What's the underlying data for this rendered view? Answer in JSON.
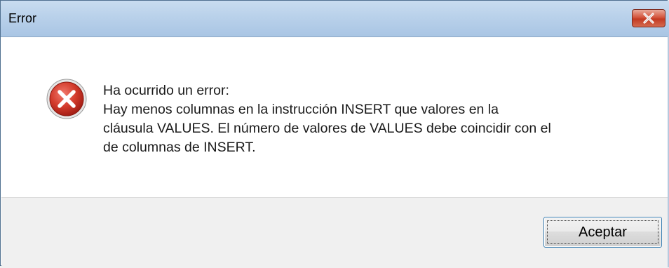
{
  "window": {
    "title": "Error"
  },
  "titlebar": {
    "close_icon": "close-x-icon"
  },
  "message": {
    "icon": "error-icon",
    "lines": [
      "Ha ocurrido un error:",
      "Hay menos columnas en la instrucción INSERT que valores en la",
      "cláusula VALUES. El número de valores de VALUES debe coincidir con el",
      "de columnas de INSERT."
    ]
  },
  "buttons": {
    "accept_label": "Aceptar"
  },
  "colors": {
    "titlebar": "#b9d1ea",
    "close_button": "#c33a22",
    "error_icon": "#c8261a",
    "footer": "#f0f0f0"
  }
}
